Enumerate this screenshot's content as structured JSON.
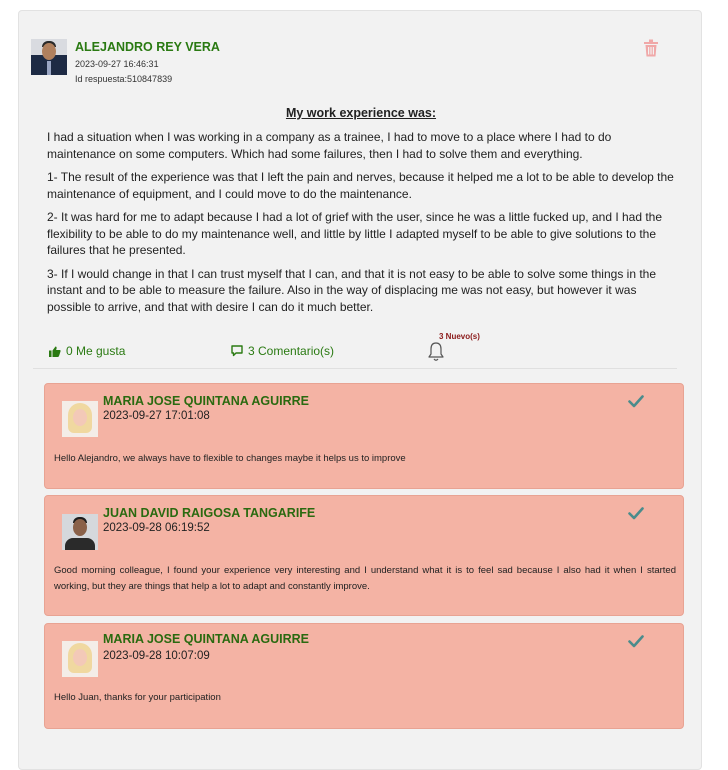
{
  "post": {
    "author": "ALEJANDRO REY VERA",
    "datetime": "2023-09-27 16:46:31",
    "response_id": "Id respuesta:510847839",
    "section_title": "My work experience was:",
    "paragraphs": [
      "I had a situation when I was working in a company as a trainee, I had to move to a place where I had to do maintenance on some computers. Which had some failures, then I had to solve them and everything.",
      "1- The result of the experience was that I left the pain and nerves, because it helped me a lot to be able to develop the maintenance of equipment, and I could move to do the maintenance.",
      "2- It was hard for me to adapt because I had a lot of grief with the user, since he was a little fucked up, and I had the flexibility to be able to do my maintenance well, and little by little I adapted myself to be able to give solutions to the failures that he presented.",
      "3- If I would change in that I can trust myself that I can, and that it is not easy to be able to solve some things in the instant and to be able to measure the failure. Also in the way of displacing me was not easy, but however it was possible to arrive, and that with desire I can do it much better."
    ],
    "likes_label": "0 Me gusta",
    "comments_label": "3 Comentario(s)",
    "new_notifications": "3 Nuevo(s)"
  },
  "icons": {
    "delete": "trash-icon",
    "like": "thumbs-up-icon",
    "comment": "comment-icon",
    "notifications": "bell-icon",
    "verified": "check-icon"
  },
  "colors": {
    "accent_green": "#2a7a12",
    "comment_bg": "#f4b3a4",
    "check": "#4a8c8c",
    "trash": "#f0a8a8",
    "new_badge": "#8b1a1a"
  },
  "comments": [
    {
      "name": "MARIA JOSE QUINTANA AGUIRRE",
      "datetime": "2023-09-27 17:01:08",
      "text": "Hello Alejandro, we always have to flexible to changes maybe it helps us to improve"
    },
    {
      "name": "JUAN DAVID RAIGOSA TANGARIFE",
      "datetime": "2023-09-28 06:19:52",
      "text": "Good morning colleague, I found your experience very interesting and I understand what it is to feel sad because I also had it when I started working, but they are things that help a lot to adapt and constantly improve."
    },
    {
      "name": "MARIA JOSE QUINTANA AGUIRRE",
      "datetime": "2023-09-28 10:07:09",
      "text": "Hello Juan, thanks for your participation"
    }
  ]
}
